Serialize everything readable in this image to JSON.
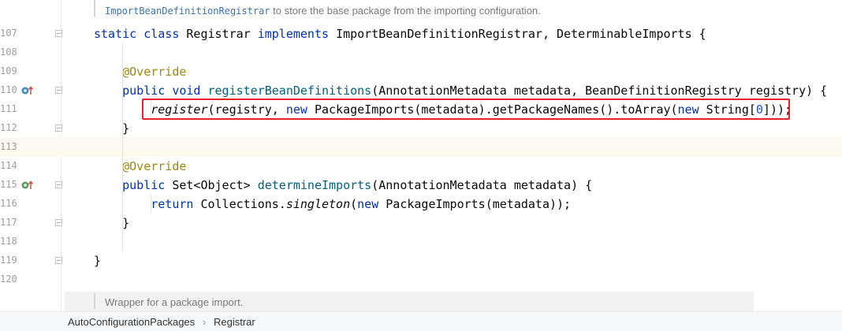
{
  "editor": {
    "doc_top": {
      "link": "ImportBeanDefinitionRegistrar",
      "text": " to store the base package from the importing configuration."
    },
    "line_numbers": [
      "107",
      "108",
      "109",
      "110",
      "111",
      "112",
      "113",
      "114",
      "115",
      "116",
      "117",
      "118",
      "119",
      "120"
    ],
    "lines": [
      {
        "n": "107",
        "segments": [
          [
            "kw",
            "static class "
          ],
          [
            "",
            "Registrar "
          ],
          [
            "kw",
            "implements "
          ],
          [
            "",
            "ImportBeanDefinitionRegistrar, DeterminableImports {"
          ]
        ]
      },
      {
        "n": "108",
        "segments": []
      },
      {
        "n": "109",
        "segments": [
          [
            "ann",
            "    @Override"
          ]
        ]
      },
      {
        "n": "110",
        "segments": [
          [
            "kw",
            "    public void "
          ],
          [
            "fn",
            "registerBeanDefinitions"
          ],
          [
            "",
            "(AnnotationMetadata metadata, BeanDefinitionRegistry registry) {"
          ]
        ]
      },
      {
        "n": "111",
        "segments": [
          [
            "",
            "        "
          ],
          [
            "it",
            "register"
          ],
          [
            "",
            "(registry, "
          ],
          [
            "kw",
            "new "
          ],
          [
            "",
            "PackageImports(metadata).getPackageNames().toArray("
          ],
          [
            "kw",
            "new "
          ],
          [
            "",
            "String["
          ],
          [
            "num",
            "0"
          ],
          [
            "",
            "]));"
          ]
        ]
      },
      {
        "n": "112",
        "segments": [
          [
            "",
            "    }"
          ]
        ]
      },
      {
        "n": "113",
        "segments": []
      },
      {
        "n": "114",
        "segments": [
          [
            "ann",
            "    @Override"
          ]
        ]
      },
      {
        "n": "115",
        "segments": [
          [
            "kw",
            "    public "
          ],
          [
            "",
            "Set<Object> "
          ],
          [
            "fn",
            "determineImports"
          ],
          [
            "",
            "(AnnotationMetadata metadata) {"
          ]
        ]
      },
      {
        "n": "116",
        "segments": [
          [
            "kw",
            "        return "
          ],
          [
            "",
            "Collections."
          ],
          [
            "it",
            "singleton"
          ],
          [
            "",
            "("
          ],
          [
            "kw",
            "new "
          ],
          [
            "",
            "PackageImports(metadata));"
          ]
        ]
      },
      {
        "n": "117",
        "segments": [
          [
            "",
            "    }"
          ]
        ]
      },
      {
        "n": "118",
        "segments": []
      },
      {
        "n": "119",
        "segments": [
          [
            "",
            "}"
          ]
        ]
      },
      {
        "n": "120",
        "segments": []
      }
    ],
    "doc_bottom": "Wrapper for a package import.",
    "current_line": "113",
    "gutter_icons": [
      {
        "line": "110",
        "name": "override-implements-icon"
      },
      {
        "line": "115",
        "name": "implements-method-icon"
      }
    ]
  },
  "breadcrumb": {
    "items": [
      "AutoConfigurationPackages",
      "Registrar"
    ],
    "separator": "›"
  },
  "colors": {
    "keyword": "#0033b3",
    "annotation": "#9e880d",
    "method": "#00627a",
    "number": "#1750eb",
    "highlight_box": "#e8202a"
  }
}
